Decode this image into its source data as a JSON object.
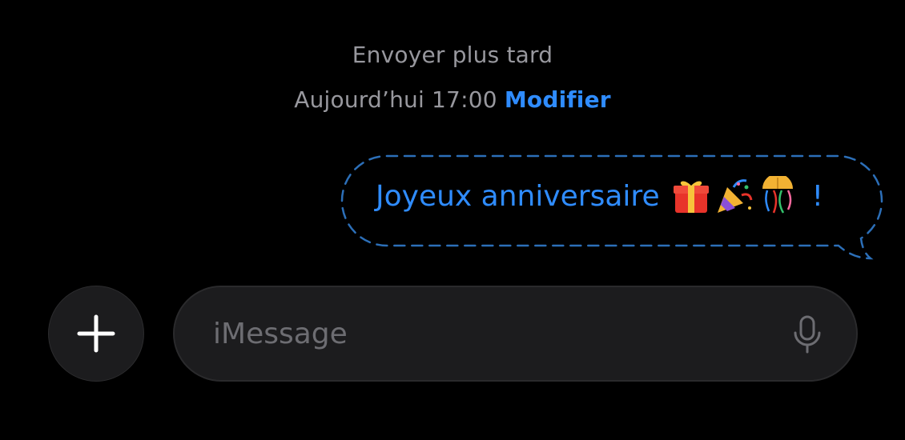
{
  "schedule": {
    "title": "Envoyer plus tard",
    "time": "Aujourd’hui 17:00",
    "edit_label": "Modifier"
  },
  "message": {
    "text": "Joyeux anniversaire",
    "punctuation": "!",
    "emojis": [
      "gift-emoji",
      "party-popper-emoji",
      "confetti-ball-emoji"
    ],
    "style": "scheduled-dashed-outline",
    "accent_color": "#2f8cff"
  },
  "composer": {
    "add_icon": "plus-icon",
    "placeholder": "iMessage",
    "mic_icon": "microphone-icon"
  },
  "colors": {
    "background": "#000000",
    "secondary_text": "#98989e",
    "accent": "#2f8cff",
    "field_background": "#1c1c1e"
  }
}
